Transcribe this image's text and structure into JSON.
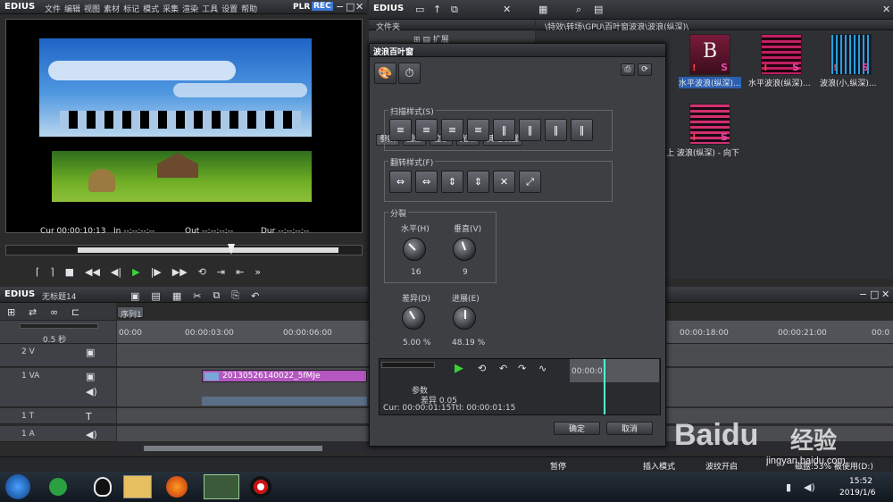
{
  "player": {
    "app": "EDIUS",
    "menu": [
      "文件",
      "编辑",
      "视图",
      "素材",
      "标记",
      "模式",
      "采集",
      "渲染",
      "工具",
      "设置",
      "帮助"
    ],
    "plr": "PLR",
    "rec": "REC",
    "cur": "Cur 00:00:10:13",
    "in": "In --:--:--:--",
    "out": "Out --:--:--:--",
    "dur": "Dur --:--:--:--"
  },
  "bin": {
    "app": "EDIUS",
    "folder_header": "文件夹",
    "tree_item": "扩展",
    "path": "\\特效\\转场\\GPU\\百叶窗波浪\\波浪(纵深)\\",
    "items": [
      {
        "label": "水平波浪(纵深)...",
        "selected": true,
        "mark": "B"
      },
      {
        "label": "水平波浪(纵深)...",
        "selected": false,
        "mark": ""
      },
      {
        "label": "波浪(小,纵深)...",
        "selected": false,
        "mark": ""
      },
      {
        "label": "上 波浪(纵深) - 向下",
        "selected": false,
        "mark": ""
      }
    ],
    "mark_s": "S",
    "mark_excl": "!"
  },
  "timeline": {
    "app": "EDIUS",
    "title": "无标题14",
    "sequence_tab": "序列1",
    "zoom": "0.5 秒",
    "ruler": [
      "00:00",
      "00:00:03:00",
      "00:00:06:00",
      "00:00:18:00",
      "00:00:21:00",
      "00:0"
    ],
    "tracks": [
      {
        "name": "2 V"
      },
      {
        "name": "1 VA",
        "clip": "20130526140022_5fMJe"
      },
      {
        "name": "1 T"
      },
      {
        "name": "1 A"
      }
    ]
  },
  "dialog": {
    "title": "波浪百叶窗",
    "tabs": [
      "参数",
      "图像",
      "位移",
      "光照",
      "其他设置"
    ],
    "scan_group": "扫描样式(S)",
    "flip_group": "翻转样式(F)",
    "split_group": "分裂",
    "horizontal_label": "水平(H)",
    "vertical_label": "垂直(V)",
    "horizontal_value": "16",
    "vertical_value": "9",
    "diff_label": "差异(D)",
    "progress_label": "进展(E)",
    "diff_value": "5.00 %",
    "progress_value": "48.19 %",
    "kf_time": "00:00:0",
    "kf_params": "参数",
    "kf_diff": "差异 0.05",
    "cur": "Cur: 00:00:01:15",
    "ttl": "Ttl: 00:00:01:15",
    "ok": "确定",
    "cancel": "取消"
  },
  "status": {
    "pause": "暂停",
    "insert": "插入模式",
    "wave": "波纹开启",
    "disk": "磁盘:53% 被使用(D:)"
  },
  "taskbar": {
    "time": "15:52",
    "date": "2019/1/6"
  },
  "watermark": {
    "brand": "Baidu",
    "jingyan": "经验",
    "url": "jingyan.baidu.com"
  }
}
